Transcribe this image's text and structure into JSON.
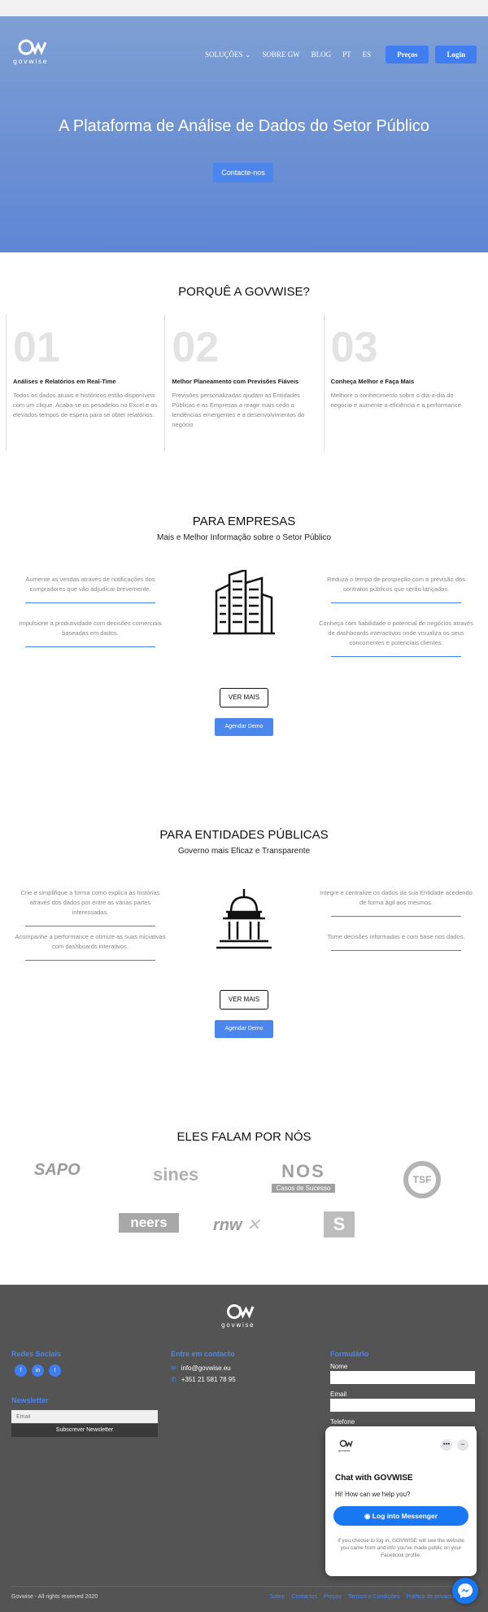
{
  "header": {
    "logo_text": "govwise",
    "nav": [
      "SOLUÇÕES",
      "SOBRE GW",
      "BLOG",
      "PT",
      "ES"
    ],
    "price_button": "Preços",
    "login_button": "Login"
  },
  "hero": {
    "title": "A Plataforma de Análise de Dados do Setor Público",
    "cta": "Contacte-nos"
  },
  "why": {
    "title": "PORQUÊ A GOVWISE?",
    "items": [
      {
        "num": "01",
        "heading": "Análises e Relatórios em Real-Time",
        "text": "Todos os dados atuais e históricos estão disponíveis com um clique. Acaba-se os pesadelos no Excel e os elevados tempos de espera para se obter relatórios."
      },
      {
        "num": "02",
        "heading": "Melhor Planeamento com Previsões Fiáveis",
        "text": "Previsões personalizadas ajudam as Entidades Públicas e as Empresas a reagir mais cedo a tendências emergentes e a desenvolvimentos do negócio"
      },
      {
        "num": "03",
        "heading": "Conheça Melhor e Faça Mais",
        "text": "Melhore o conhecimento sobre o dia-a-dia do negócio e aumente a eficiência e a performance."
      }
    ]
  },
  "empresas": {
    "title": "PARA EMPRESAS",
    "subtitle": "Mais e Melhor Informação sobre o Setor Público",
    "left": [
      "Aumente as vendas através de notificações dos compradores que vão adjudicar brevemente.",
      "Impulsione a produtividade com decisões comerciais baseadas em dados."
    ],
    "right": [
      "Reduza o tempo de prospeção com a previsão dos contratos públicos que serão lançados.",
      "Conheça com fiabilidade o potencial de negócios através de dashboards interactivos onde visualiza os seus concorrentes e potenciais clientes."
    ],
    "more_button": "VER MAIS",
    "demo_button": "Agendar Demo"
  },
  "entidades": {
    "title": "PARA ENTIDADES PÚBLICAS",
    "subtitle": "Governo mais Eficaz e Transparente",
    "left": [
      "Crie e simplifique a forma como explica as histórias através dos dados por entre as várias partes interessadas.",
      "Acompanhe a performance e otimize as suas iniciativas com dashboards interativos."
    ],
    "right": [
      "Integre e centralize os dados da sua Entidade acedendo de forma ágil aos mesmos.",
      "Tome decisões informadas e com base nos dados."
    ],
    "more_button": "VER MAIS",
    "demo_button": "Agendar Demo"
  },
  "press": {
    "title": "ELES FALAM POR NÓS",
    "logos": [
      "SAPO",
      "sines",
      "NOS",
      "Casos de Sucesso",
      "TSF",
      "neers",
      "rnw",
      "S"
    ]
  },
  "footer": {
    "logo_text": "govwise",
    "social_heading": "Redes Sociais",
    "social": [
      "f",
      "in",
      "t"
    ],
    "newsletter_heading": "Newsletter",
    "email_placeholder": "Email",
    "subscribe_button": "Subscrever Newsletter",
    "contact_heading": "Entre em contacto",
    "email": "info@govwise.eu",
    "phone": "+351 21 581 78 95",
    "form_heading": "Formulário",
    "form_labels": [
      "Nome",
      "Email",
      "Telefone"
    ],
    "copyright": "Govwise - All rights reserved 2020",
    "links": [
      "Sobre",
      "Contactos",
      "Preços",
      "Termos e Condições",
      "Política de privacidade"
    ]
  },
  "chat": {
    "logo_text": "govwise",
    "title": "Chat with GOVWISE",
    "subtitle": "Hi! How can we help you?",
    "button": "Log into Messenger",
    "fine_print": "If you choose to log in, GOVWISE will see the website you came from and info you've made public on your Facebook profile."
  },
  "colors": {
    "accent": "#4a86ee",
    "footer_bg": "#545454",
    "messenger": "#1877f2"
  }
}
